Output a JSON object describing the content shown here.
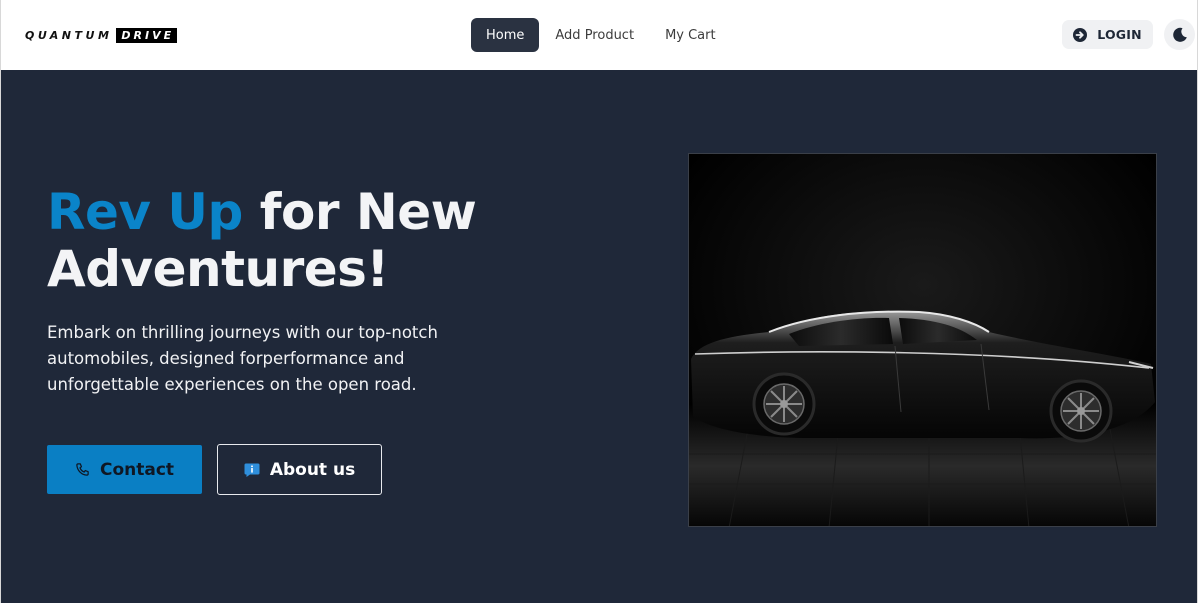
{
  "brand": {
    "logo_word1": "QUANTUM",
    "logo_word2": "DRIVE"
  },
  "nav": {
    "items": [
      {
        "label": "Home",
        "active": true
      },
      {
        "label": "Add Product",
        "active": false
      },
      {
        "label": "My Cart",
        "active": false
      }
    ]
  },
  "header": {
    "login_label": "LOGIN",
    "login_icon": "sign-in-arrow-icon",
    "theme_icon": "moon-icon"
  },
  "hero": {
    "headline_accent": "Rev Up",
    "headline_rest": " for New Adventures!",
    "subtext": "Embark on thrilling journeys with our top-notch automobiles, designed forperformance and unforgettable experiences on the open road.",
    "contact_label": "Contact",
    "contact_icon": "phone-icon",
    "about_label": "About us",
    "about_icon": "info-chat-icon",
    "image_subject": "black sedan car in dark studio"
  },
  "colors": {
    "accent": "#0a84c9",
    "hero_bg": "#1f2839",
    "nav_active_bg": "#2a3241",
    "contact_bg": "#0a7fc4"
  }
}
